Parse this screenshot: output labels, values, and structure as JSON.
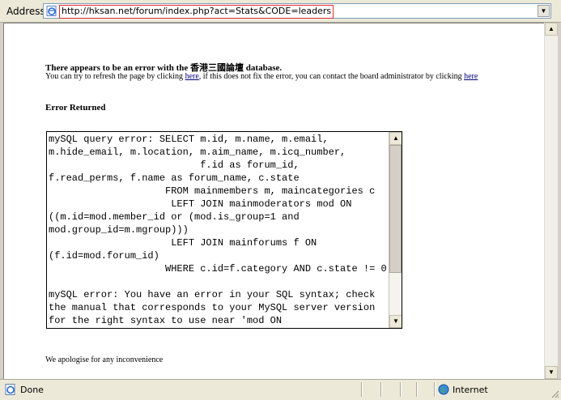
{
  "address_bar": {
    "label": "Address",
    "url": "http://hksan.net/forum/index.php?act=Stats&CODE=leaders"
  },
  "page": {
    "error_title": "There appears to be an error with the 香港三國論壇 database.",
    "desc_part1": "You can try to refresh the page by clicking ",
    "link1": "here",
    "desc_part2": ", if this does not fix the error, you can contact the board administrator by clicking ",
    "link2": "here",
    "error_returned": "Error Returned",
    "sql_error_text": "mySQL query error: SELECT m.id, m.name, m.email,\nm.hide_email, m.location, m.aim_name, m.icq_number,\n                          f.id as forum_id,\nf.read_perms, f.name as forum_name, c.state\n                    FROM mainmembers m, maincategories c\n                     LEFT JOIN mainmoderators mod ON\n((m.id=mod.member_id or (mod.is_group=1 and\nmod.group_id=m.mgroup)))\n                     LEFT JOIN mainforums f ON\n(f.id=mod.forum_id)\n                    WHERE c.id=f.category AND c.state != 0\n\nmySQL error: You have an error in your SQL syntax; check\nthe manual that corresponds to your MySQL server version\nfor the right syntax to use near 'mod ON",
    "apology": "We apologise for any inconvenience"
  },
  "status_bar": {
    "status": "Done",
    "zone": "Internet"
  },
  "icons": [
    "ie-page-icon",
    "dropdown-arrow-icon",
    "scroll-up-icon",
    "scroll-down-icon",
    "globe-icon",
    "resize-grip-icon"
  ]
}
